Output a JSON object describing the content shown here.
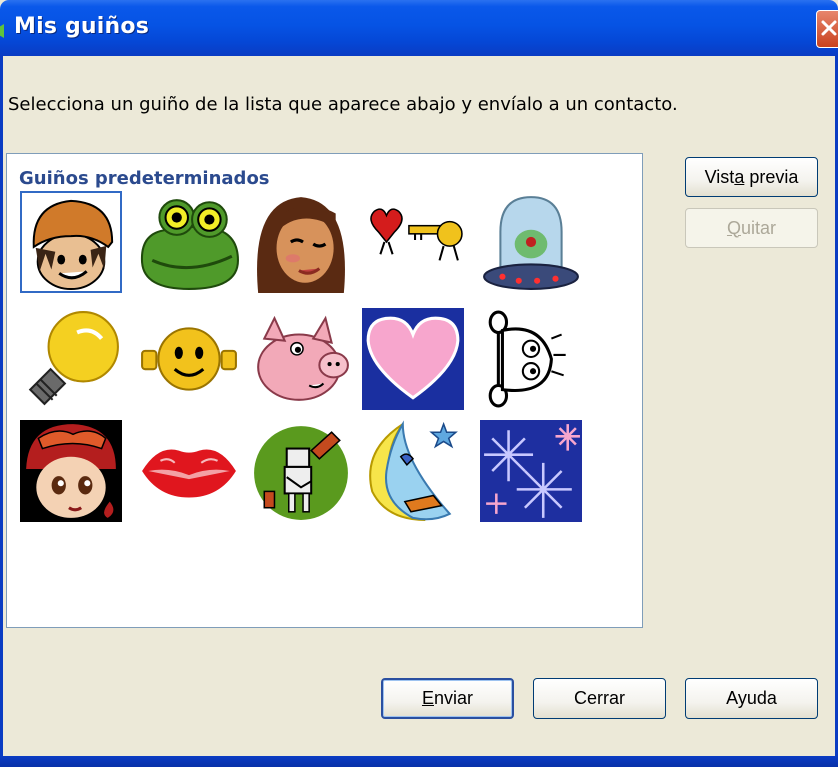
{
  "window": {
    "title": "Mis guiños"
  },
  "instruction": "Selecciona un guiño de la lista que aparece abajo y envíalo a un contacto.",
  "list": {
    "group_label": "Guiños predeterminados",
    "selected_index": 0,
    "items": [
      {
        "icon": "boy-orange-beanie-icon"
      },
      {
        "icon": "frog-icon"
      },
      {
        "icon": "winking-girl-icon"
      },
      {
        "icon": "heart-and-key-icon"
      },
      {
        "icon": "alien-ufo-icon"
      },
      {
        "icon": "lightbulb-icon"
      },
      {
        "icon": "smiley-face-icon"
      },
      {
        "icon": "pig-icon"
      },
      {
        "icon": "pink-heart-icon"
      },
      {
        "icon": "peeking-face-icon"
      },
      {
        "icon": "girl-red-beanie-icon"
      },
      {
        "icon": "lips-kiss-icon"
      },
      {
        "icon": "robot-guitar-icon"
      },
      {
        "icon": "moon-star-icon"
      },
      {
        "icon": "sparkles-icon"
      }
    ]
  },
  "buttons": {
    "preview": {
      "label": "Vista previa",
      "accesskey": "a"
    },
    "remove": {
      "label": "Quitar",
      "accesskey": "Q",
      "enabled": false
    },
    "send": {
      "label": "Enviar",
      "accesskey": "E"
    },
    "close": {
      "label": "Cerrar"
    },
    "help": {
      "label": "Ayuda"
    }
  },
  "colors": {
    "title_bar": "#0a58ea",
    "dialog_bg": "#ece9d8",
    "group_label": "#2b4a8e",
    "selection_border": "#316ac5"
  }
}
